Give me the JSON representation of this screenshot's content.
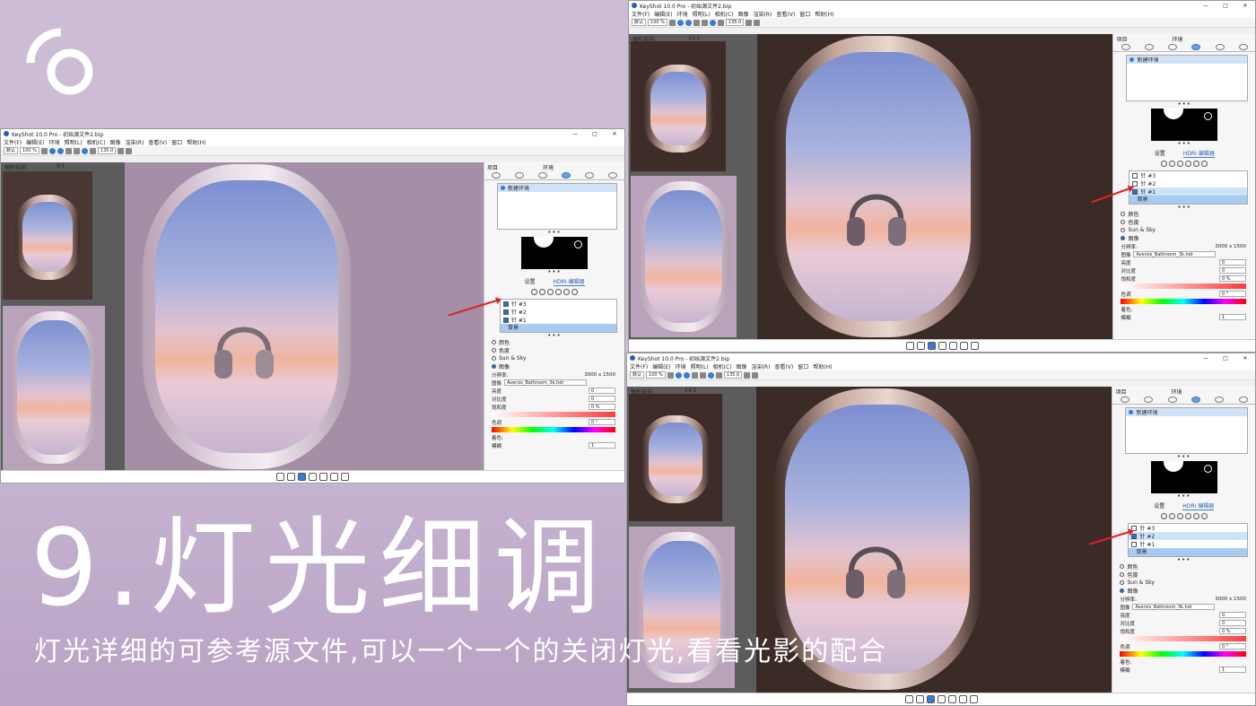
{
  "slide": {
    "title": "9.灯光细调",
    "subtitle": "灯光详细的可参考源文件,可以一个一个的关闭灯光,看看光影的配合"
  },
  "app": {
    "window_title": "KeyShot 10.0 Pro - 初始源文件2.bip",
    "menu": [
      "文件(F)",
      "编辑(E)",
      "环境",
      "照明(L)",
      "相机(C)",
      "图像",
      "渲染(R)",
      "查看(V)",
      "窗口",
      "帮助(H)"
    ],
    "toolbar": {
      "preset": "默认",
      "zoom": "100 %",
      "fov": "135.0"
    },
    "thumbs_label": "每秒采样:",
    "panel": {
      "header_left": "项目",
      "header_center": "环境",
      "env_name": "新建环境",
      "subtabs": [
        "设置",
        "HDRI 编辑器"
      ],
      "lights": [
        "针 #3",
        "针 #2",
        "针 #1"
      ],
      "background_row": "背景",
      "options": [
        "颜色",
        "色度",
        "Sun & Sky",
        "图像"
      ],
      "resolution_label": "分辨率:",
      "resolution_value": "3000 x 1500",
      "image_label": "图像",
      "image_file": "Aversis_Bathroom_3k.hdr",
      "brightness_label": "亮度",
      "contrast_label": "对比度",
      "saturation_label": "饱和度",
      "hue_label": "色调",
      "tint_label": "着色:",
      "blur_label": "模糊",
      "zero": "0",
      "one": "1",
      "pct": "0 %",
      "deg": "0 °"
    }
  },
  "windows": [
    {
      "fps": "9.1",
      "checked": [
        true,
        true,
        true
      ],
      "selected": -1
    },
    {
      "fps": "13.2",
      "checked": [
        false,
        false,
        true
      ],
      "selected": 2
    },
    {
      "fps": "24.5",
      "checked": [
        false,
        true,
        false
      ],
      "selected": 1
    }
  ],
  "colors": {
    "accent": "#3a7bd5",
    "arrow": "#e02020",
    "slide_bg": "#cdbcd6"
  }
}
